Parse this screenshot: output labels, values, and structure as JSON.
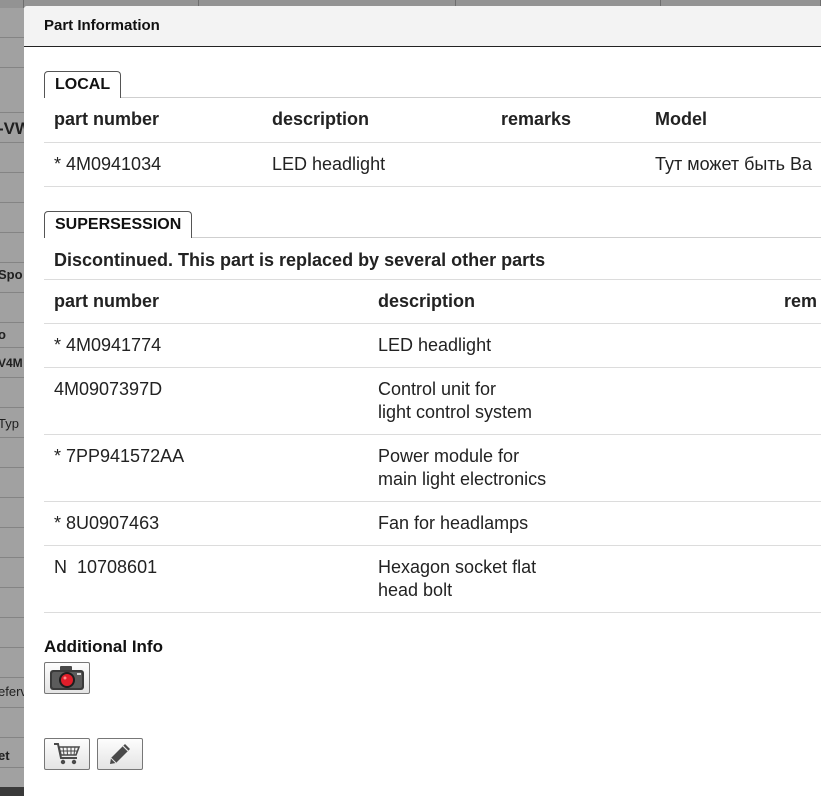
{
  "background": {
    "row_fragments": [
      "-VW",
      "Spo",
      "o",
      "V4M",
      "Typ",
      "eferv",
      "et"
    ]
  },
  "dialog": {
    "title": "Part Information"
  },
  "local": {
    "tab_label": "LOCAL",
    "columns": [
      "part number",
      "description",
      "remarks",
      "Model"
    ],
    "rows": [
      {
        "part_number": "* 4M0941034",
        "description": "LED headlight",
        "remarks": "",
        "model": "Тут может быть Ва"
      }
    ]
  },
  "supersession": {
    "tab_label": "SUPERSESSION",
    "notice": "Discontinued. This part is replaced by several other parts",
    "columns": [
      "part number",
      "description",
      "rem"
    ],
    "rows": [
      {
        "part_number": "* 4M0941774",
        "description": "LED headlight",
        "remarks": ""
      },
      {
        "part_number": "4M0907397D",
        "description": "Control unit for\nlight control system",
        "remarks": ""
      },
      {
        "part_number": "* 7PP941572AA",
        "description": "Power module for\nmain light electronics",
        "remarks": ""
      },
      {
        "part_number": "* 8U0907463",
        "description": "Fan for headlamps",
        "remarks": ""
      },
      {
        "part_number": "N  10708601",
        "description": "Hexagon socket flat\nhead bolt",
        "remarks": ""
      }
    ]
  },
  "additional_info": {
    "title": "Additional Info",
    "photo_button_icon": "camera-icon"
  },
  "actions": {
    "cart_button_icon": "shopping-cart-icon",
    "edit_button_icon": "pencil-icon"
  }
}
